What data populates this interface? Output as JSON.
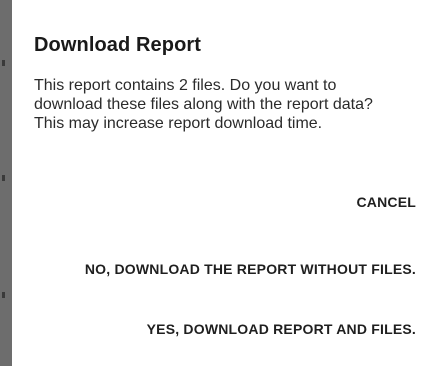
{
  "dialog": {
    "title": "Download Report",
    "message": "This report contains 2 files. Do you want to download these files along with the report data? This may increase report download time.",
    "buttons": {
      "cancel": "CANCEL",
      "no": "NO, DOWNLOAD THE REPORT WITHOUT FILES.",
      "yes": "YES, DOWNLOAD REPORT AND FILES."
    }
  },
  "colors": {
    "backdrop": "#6d6d6d",
    "dialog_bg": "#ffffff",
    "text": "#1f1f1f"
  }
}
